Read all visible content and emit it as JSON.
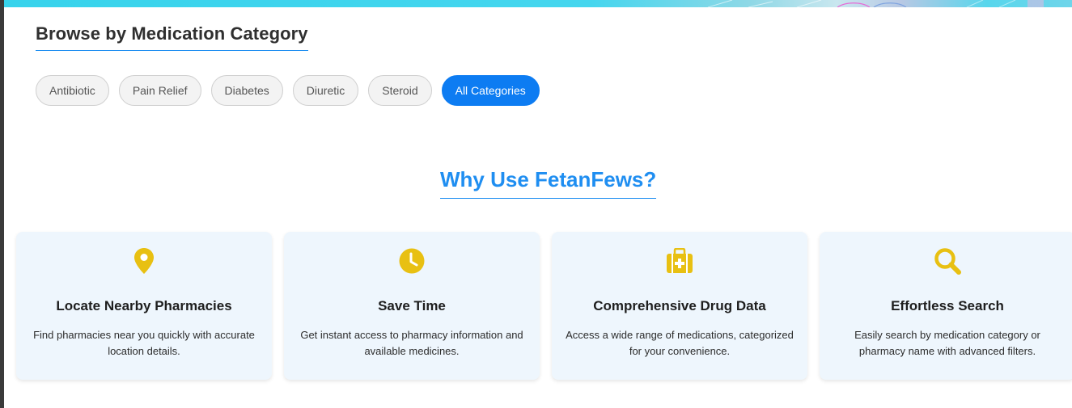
{
  "categories": {
    "heading": "Browse by Medication Category",
    "items": [
      {
        "label": "Antibiotic",
        "active": false
      },
      {
        "label": "Pain Relief",
        "active": false
      },
      {
        "label": "Diabetes",
        "active": false
      },
      {
        "label": "Diuretic",
        "active": false
      },
      {
        "label": "Steroid",
        "active": false
      },
      {
        "label": "All Categories",
        "active": true
      }
    ]
  },
  "why": {
    "heading": "Why Use FetanFews?",
    "features": [
      {
        "icon": "map-pin-icon",
        "title": "Locate Nearby Pharmacies",
        "description": "Find pharmacies near you quickly with accurate location details."
      },
      {
        "icon": "clock-icon",
        "title": "Save Time",
        "description": "Get instant access to pharmacy information and available medicines."
      },
      {
        "icon": "medical-kit-icon",
        "title": "Comprehensive Drug Data",
        "description": "Access a wide range of medications, categorized for your convenience."
      },
      {
        "icon": "search-icon",
        "title": "Effortless Search",
        "description": "Easily search by medication category or pharmacy name with advanced filters."
      }
    ]
  },
  "colors": {
    "accent": "#1f8ef1",
    "active_pill": "#0d7cf2",
    "icon": "#e8c012",
    "card_bg": "#eef6fd"
  }
}
